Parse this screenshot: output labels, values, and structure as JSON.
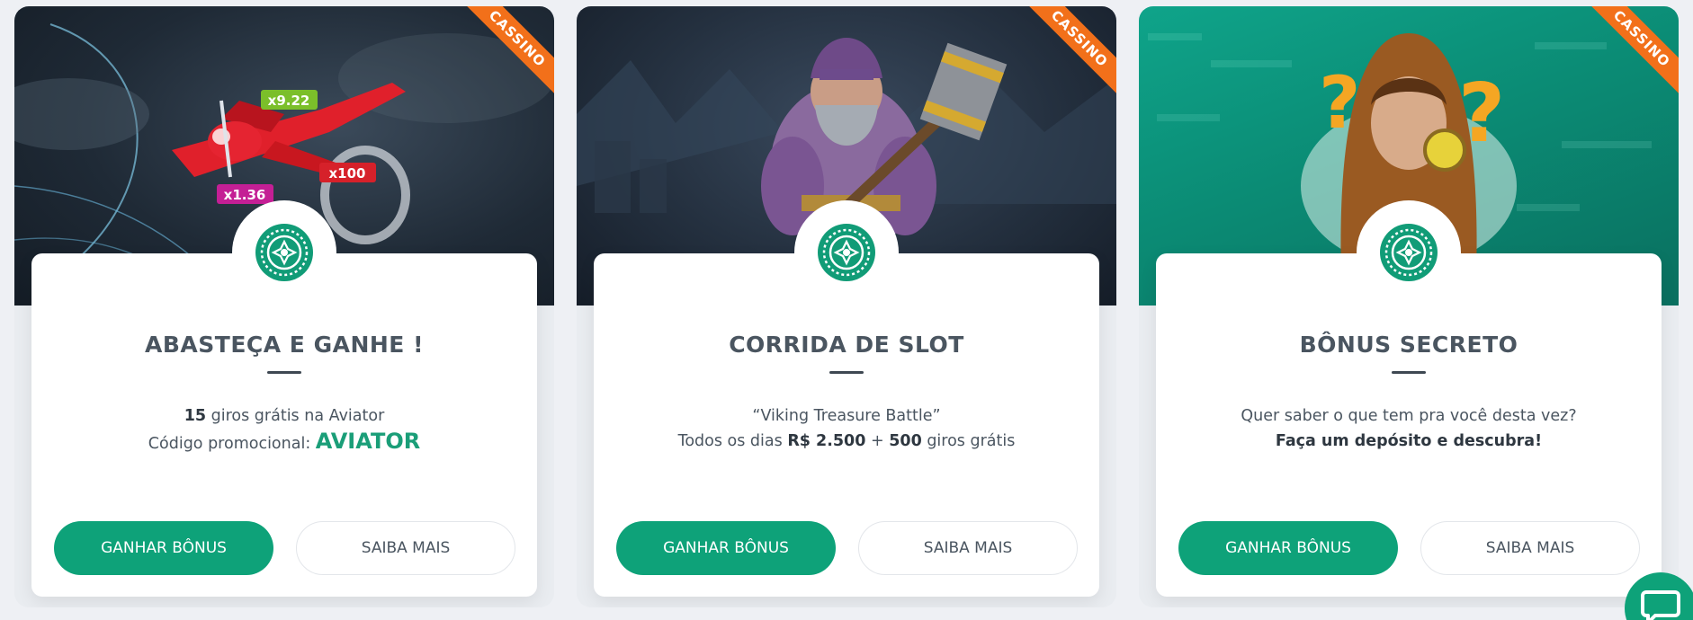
{
  "cards": [
    {
      "ribbon": "CASSINO",
      "title": "ABASTEÇA E GANHE !",
      "line1_count": "15",
      "line1_text": " giros grátis na Aviator",
      "line2_text": "Código promocional: ",
      "promo_code": "AVIATOR",
      "primary_button": "GANHAR BÔNUS",
      "secondary_button": "SAIBA MAIS",
      "multipliers": [
        "x9.22",
        "x100",
        "x1.36"
      ]
    },
    {
      "ribbon": "CASSINO",
      "title": "CORRIDA DE SLOT",
      "line1_text": "“Viking Treasure Battle”",
      "line2_prefix": "Todos os dias ",
      "line2_amount": "R$ 2.500",
      "line2_plus": " + ",
      "line2_count": "500",
      "line2_suffix": " giros grátis",
      "primary_button": "GANHAR BÔNUS",
      "secondary_button": "SAIBA MAIS"
    },
    {
      "ribbon": "CASSINO",
      "title": "BÔNUS SECRETO",
      "line1_text": "Quer saber o que tem pra você desta vez?",
      "line2_bold": "Faça um depósito e descubra!",
      "primary_button": "GANHAR BÔNUS",
      "secondary_button": "SAIBA MAIS"
    }
  ],
  "icons": {
    "card_icon": "roulette-wheel-icon",
    "chat": "chat-bubble-icon"
  },
  "colors": {
    "accent": "#0ea279",
    "ribbon": "#f2701a",
    "text": "#4a5560"
  }
}
